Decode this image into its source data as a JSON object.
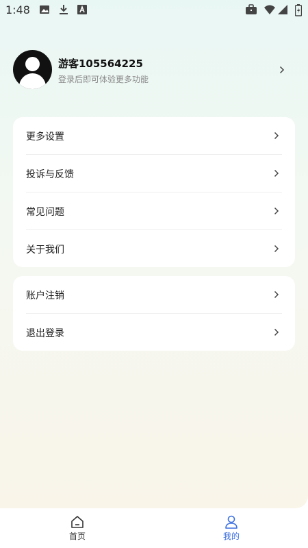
{
  "status_bar": {
    "time": "1:48",
    "icons_left": [
      "image-icon",
      "download-icon",
      "a-box-icon"
    ],
    "icons_right": [
      "briefcase-icon",
      "wifi-icon",
      "signal-icon",
      "battery-icon"
    ]
  },
  "profile": {
    "username": "游客105564225",
    "subtitle": "登录后即可体验更多功能"
  },
  "menu_group_1": [
    {
      "label": "更多设置"
    },
    {
      "label": "投诉与反馈"
    },
    {
      "label": "常见问题"
    },
    {
      "label": "关于我们"
    }
  ],
  "menu_group_2": [
    {
      "label": "账户注销"
    },
    {
      "label": "退出登录"
    }
  ],
  "bottom_nav": {
    "home_label": "首页",
    "mine_label": "我的",
    "active_color": "#3b6fe0",
    "inactive_color": "#333333"
  }
}
